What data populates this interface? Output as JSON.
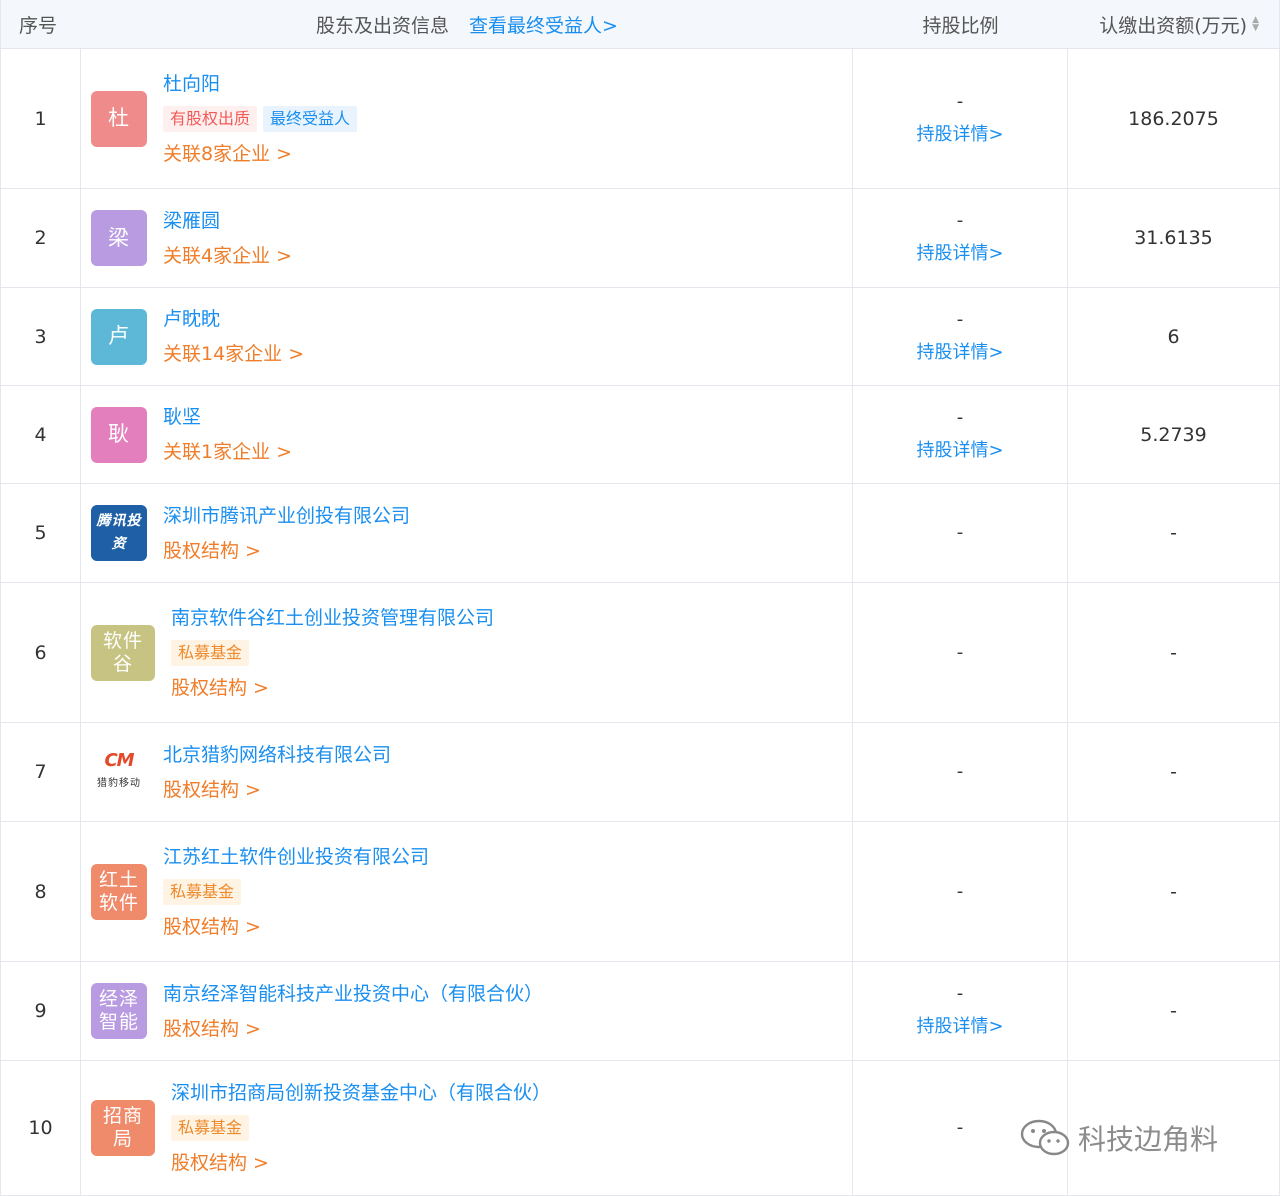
{
  "header": {
    "col_index": "序号",
    "col_shareholder": "股东及出资信息",
    "view_beneficiary": "查看最终受益人>",
    "col_ratio": "持股比例",
    "col_amount": "认缴出资额(万元)"
  },
  "rows": [
    {
      "index": "1",
      "avatar": "杜",
      "color": "#ef8b8b",
      "name": "杜向阳",
      "tags": [
        {
          "label": "有股权出质",
          "type": "red"
        },
        {
          "label": "最终受益人",
          "type": "blue"
        }
      ],
      "link": "关联8家企业 >",
      "ratio": "-",
      "detail": "持股详情>",
      "amount": "186.2075"
    },
    {
      "index": "2",
      "avatar": "梁",
      "color": "#b89be0",
      "name": "梁雁圆",
      "tags": [],
      "link": "关联4家企业 >",
      "ratio": "-",
      "detail": "持股详情>",
      "amount": "31.6135"
    },
    {
      "index": "3",
      "avatar": "卢",
      "color": "#5cb8d6",
      "name": "卢眈眈",
      "tags": [],
      "link": "关联14家企业 >",
      "ratio": "-",
      "detail": "持股详情>",
      "amount": "6"
    },
    {
      "index": "4",
      "avatar": "耿",
      "color": "#e37fbc",
      "name": "耿坚",
      "tags": [],
      "link": "关联1家企业 >",
      "ratio": "-",
      "detail": "持股详情>",
      "amount": "5.2739"
    },
    {
      "index": "5",
      "avatar": "腾讯投资",
      "color": "#1e5fa6",
      "name": "深圳市腾讯产业创投有限公司",
      "tags": [],
      "link": "股权结构 >",
      "ratio": "-",
      "detail": "",
      "amount": "-"
    },
    {
      "index": "6",
      "avatar": "软件谷",
      "color": "#c7c483",
      "name": "南京软件谷红土创业投资管理有限公司",
      "tags": [
        {
          "label": "私募基金",
          "type": "orange"
        }
      ],
      "link": "股权结构 >",
      "ratio": "-",
      "detail": "",
      "amount": "-"
    },
    {
      "index": "7",
      "avatar": "猎豹移动",
      "color": "#ffffff",
      "name": "北京猎豹网络科技有限公司",
      "tags": [],
      "link": "股权结构 >",
      "ratio": "-",
      "detail": "",
      "amount": "-"
    },
    {
      "index": "8",
      "avatar": "红土软件",
      "color": "#ef8a6a",
      "name": "江苏红土软件创业投资有限公司",
      "tags": [
        {
          "label": "私募基金",
          "type": "orange"
        }
      ],
      "link": "股权结构 >",
      "ratio": "-",
      "detail": "",
      "amount": "-"
    },
    {
      "index": "9",
      "avatar": "经泽智能",
      "color": "#b89be0",
      "name": "南京经泽智能科技产业投资中心（有限合伙）",
      "tags": [],
      "link": "股权结构 >",
      "ratio": "-",
      "detail": "持股详情>",
      "amount": "-"
    },
    {
      "index": "10",
      "avatar": "招商局",
      "color": "#ef8a6a",
      "name": "深圳市招商局创新投资基金中心（有限合伙）",
      "tags": [
        {
          "label": "私募基金",
          "type": "orange"
        }
      ],
      "link": "股权结构 >",
      "ratio": "-",
      "detail": "",
      "amount": ""
    }
  ],
  "watermark": "科技边角料"
}
